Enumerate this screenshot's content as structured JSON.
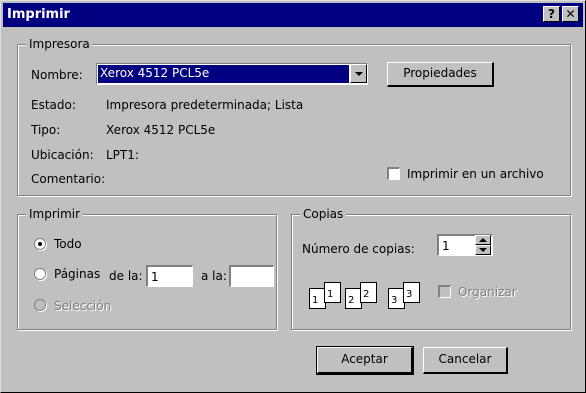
{
  "window": {
    "title": "Imprimir",
    "help_label": "?",
    "close_label": "✕"
  },
  "printer": {
    "group_label": "Impresora",
    "name_label": "Nombre:",
    "name_value": "Xerox 4512 PCL5e",
    "properties_button": "Propiedades",
    "status_label": "Estado:",
    "status_value": "Impresora predeterminada; Lista",
    "type_label": "Tipo:",
    "type_value": "Xerox 4512 PCL5e",
    "location_label": "Ubicación:",
    "location_value": "LPT1:",
    "comment_label": "Comentario:",
    "comment_value": "",
    "print_to_file_label": "Imprimir en un archivo",
    "print_to_file_checked": false
  },
  "range": {
    "group_label": "Imprimir",
    "all_label": "Todo",
    "all_selected": true,
    "pages_label": "Páginas",
    "from_label": "de la:",
    "from_value": "1",
    "to_label": "a la:",
    "to_value": "",
    "selection_label": "Selección"
  },
  "copies": {
    "group_label": "Copias",
    "count_label": "Número de copias:",
    "count_value": "1",
    "collate_label": "Organizar",
    "collate_pages": [
      "1",
      "1",
      "2",
      "2",
      "3",
      "3"
    ]
  },
  "actions": {
    "ok_label": "Aceptar",
    "cancel_label": "Cancelar"
  }
}
